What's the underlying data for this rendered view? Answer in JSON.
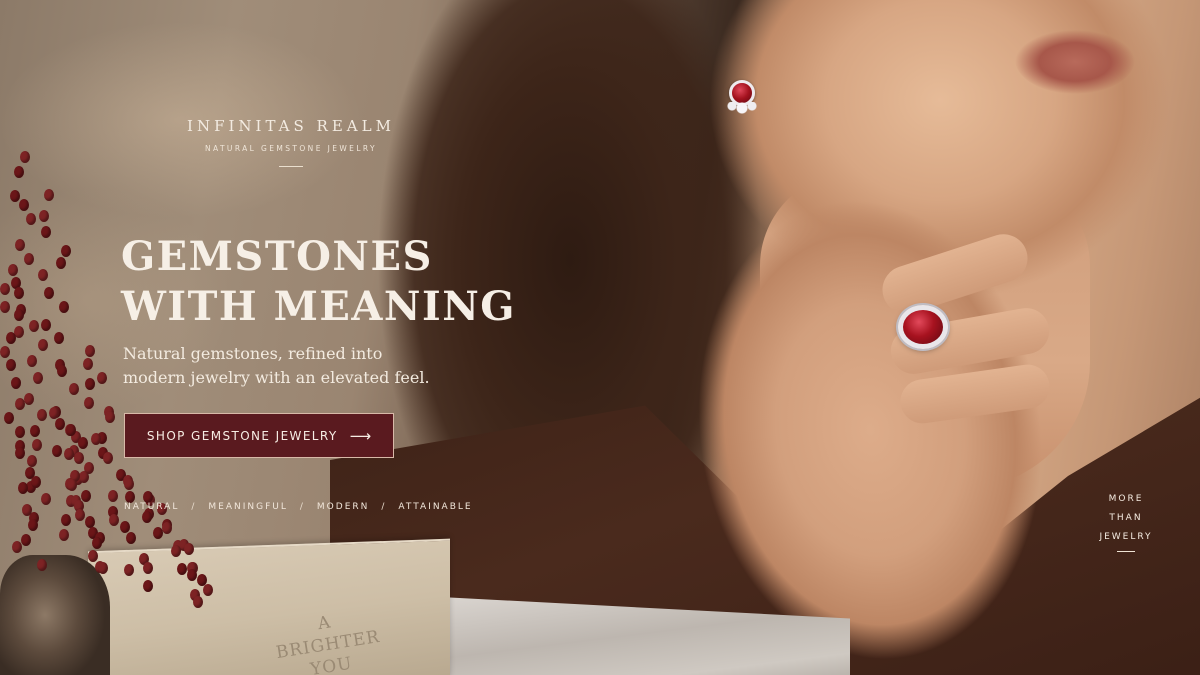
{
  "brand": {
    "name": "INFINITAS REALM",
    "tagline": "NATURAL GEMSTONE JEWELRY"
  },
  "hero": {
    "headline_line1": "GEMSTONES",
    "headline_line2": "WITH MEANING",
    "subline_line1": "Natural gemstones, refined into",
    "subline_line2": "modern jewelry with an elevated feel.",
    "cta_label": "SHOP GEMSTONE JEWELRY",
    "cta_icon": "arrow-right-icon"
  },
  "values": [
    "NATURAL",
    "MEANINGFUL",
    "MODERN",
    "ATTAINABLE"
  ],
  "value_separator": "/",
  "side_note": [
    "MORE",
    "THAN",
    "JEWELRY"
  ],
  "book_title": [
    "A BRIGHTER",
    "YOU"
  ],
  "colors": {
    "cta_background": "#5a1a1f",
    "gemstone": "#a7121f",
    "text_light": "#f6efe6"
  }
}
